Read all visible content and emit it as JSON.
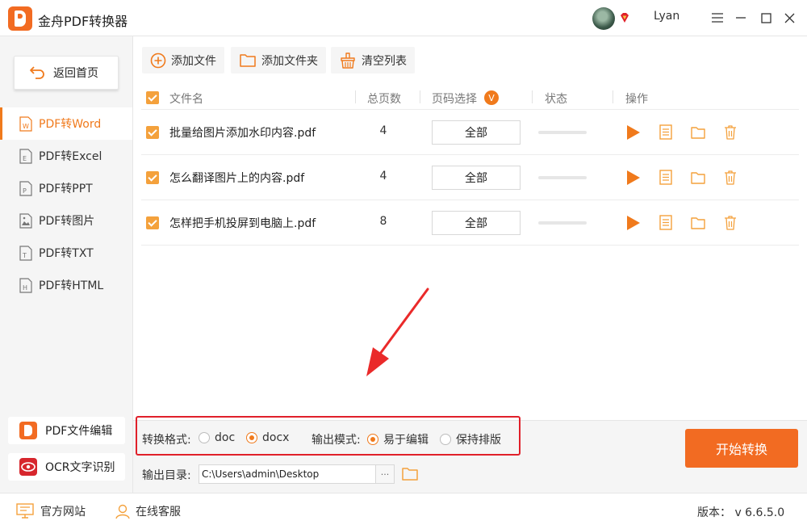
{
  "app": {
    "title": "金舟PDF转换器",
    "user_name": "Lyan",
    "accent": "#f07a1c",
    "alert_color": "#e0202a"
  },
  "window_controls": {
    "menu_icon": "menu-icon",
    "minimize_icon": "minimize-icon",
    "maximize_icon": "maximize-icon",
    "close_icon": "close-icon"
  },
  "sidebar": {
    "home_label": "返回首页",
    "items": [
      {
        "label": "PDF转Word",
        "icon_letter": "W",
        "active": true
      },
      {
        "label": "PDF转Excel",
        "icon_letter": "E",
        "active": false
      },
      {
        "label": "PDF转PPT",
        "icon_letter": "P",
        "active": false
      },
      {
        "label": "PDF转图片",
        "icon_letter": "",
        "active": false
      },
      {
        "label": "PDF转TXT",
        "icon_letter": "T",
        "active": false
      },
      {
        "label": "PDF转HTML",
        "icon_letter": "H",
        "active": false
      }
    ],
    "tools": [
      {
        "label": "PDF文件编辑"
      },
      {
        "label": "OCR文字识别"
      }
    ]
  },
  "toolbar": {
    "add_file": "添加文件",
    "add_folder": "添加文件夹",
    "clear_list": "清空列表"
  },
  "table": {
    "headers": {
      "filename": "文件名",
      "total_pages": "总页数",
      "page_select": "页码选择",
      "page_select_badge": "V",
      "status": "状态",
      "actions": "操作"
    },
    "rows": [
      {
        "filename": "批量给图片添加水印内容.pdf",
        "pages": "4",
        "page_range": "全部",
        "progress": 0
      },
      {
        "filename": "怎么翻译图片上的内容.pdf",
        "pages": "4",
        "page_range": "全部",
        "progress": 0
      },
      {
        "filename": "怎样把手机投屏到电脑上.pdf",
        "pages": "8",
        "page_range": "全部",
        "progress": 0
      }
    ]
  },
  "settings": {
    "format_label": "转换格式:",
    "formats": [
      {
        "label": "doc",
        "selected": false
      },
      {
        "label": "docx",
        "selected": true
      }
    ],
    "mode_label": "输出模式:",
    "modes": [
      {
        "label": "易于编辑",
        "selected": true
      },
      {
        "label": "保持排版",
        "selected": false
      }
    ],
    "output_label": "输出目录:",
    "output_path": "C:\\Users\\admin\\Desktop",
    "more_label": "···",
    "start_label": "开始转换"
  },
  "statusbar": {
    "website": "官方网站",
    "support": "在线客服",
    "version": "版本：  v 6.6.5.0"
  }
}
